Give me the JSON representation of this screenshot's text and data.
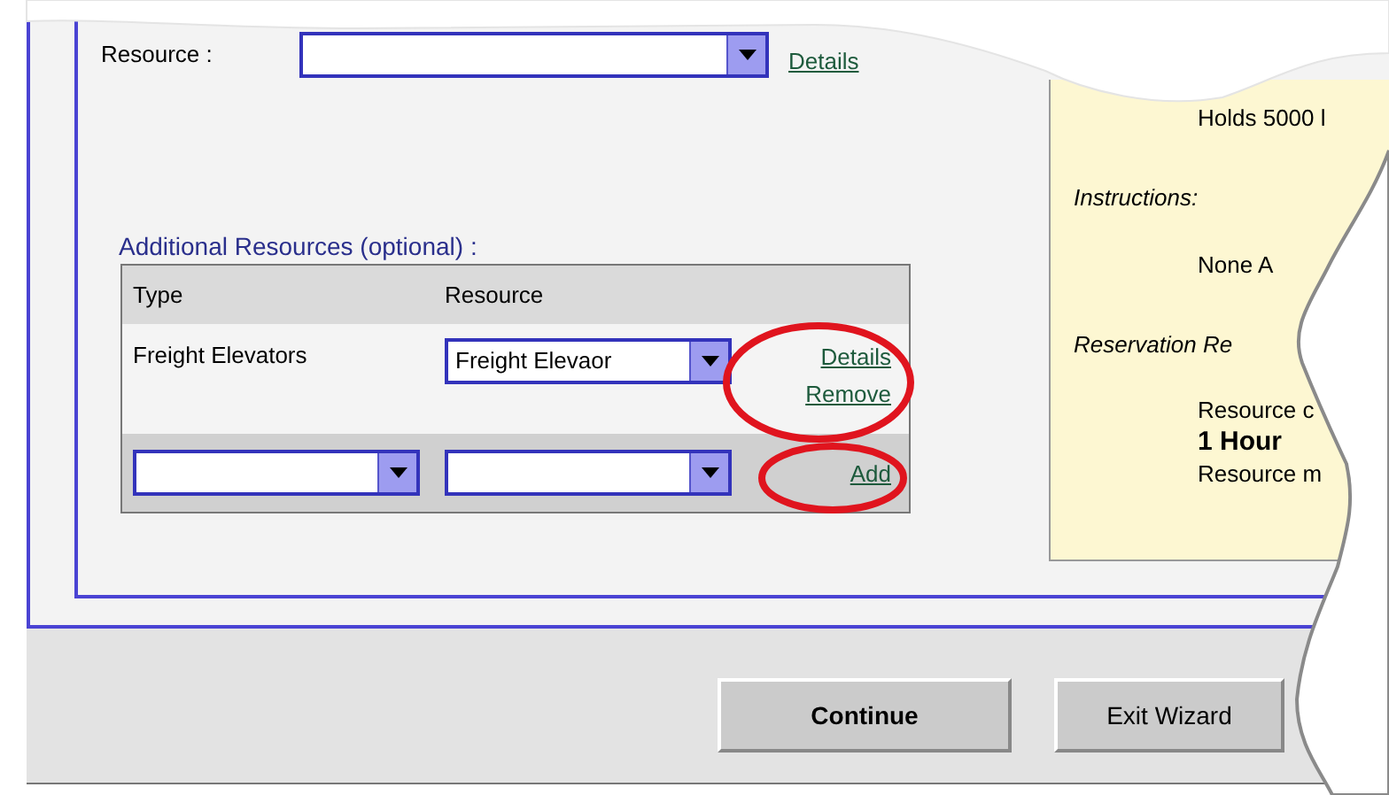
{
  "resource_field": {
    "label": "Resource :",
    "link": "Details"
  },
  "additional": {
    "heading": "Additional Resources (optional) :",
    "columns": [
      "Type",
      "Resource"
    ],
    "rows": [
      {
        "type": "Freight Elevators",
        "resource": "Freight Elevaor",
        "links": [
          "Details",
          "Remove"
        ],
        "circled": true
      }
    ],
    "new_row": {
      "link": "Add",
      "circled": true
    }
  },
  "info_panel": [
    {
      "kind": "text",
      "text": "Holds 5000 l"
    },
    {
      "kind": "heading",
      "text": "Instructions:"
    },
    {
      "kind": "text",
      "text": "None A"
    },
    {
      "kind": "heading",
      "text": "Reservation Re"
    },
    {
      "kind": "text",
      "text": "Resource c"
    },
    {
      "kind": "bold",
      "text": "1 Hour"
    },
    {
      "kind": "text",
      "text": "Resource m"
    }
  ],
  "buttons": [
    {
      "label": "Continue",
      "primary": true
    },
    {
      "label": "Exit Wizard",
      "primary": false
    }
  ]
}
